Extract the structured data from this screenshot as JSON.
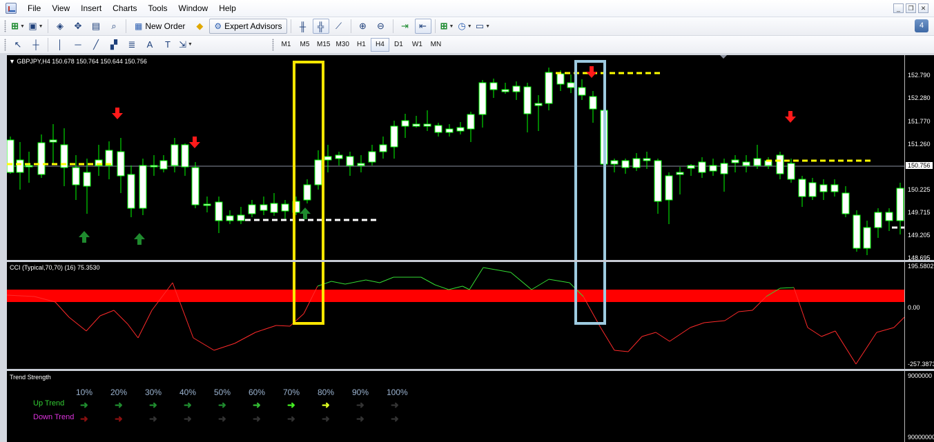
{
  "menu": {
    "items": [
      "File",
      "View",
      "Insert",
      "Charts",
      "Tools",
      "Window",
      "Help"
    ]
  },
  "window_controls": {
    "minimize": "_",
    "restore": "❐",
    "close": "✕"
  },
  "toolbar": {
    "new_order_label": "New Order",
    "expert_advisors_label": "Expert Advisors",
    "notification_count": "4",
    "timeframes": [
      "M1",
      "M5",
      "M15",
      "M30",
      "H1",
      "H4",
      "D1",
      "W1",
      "MN"
    ],
    "active_timeframe": "H4",
    "text_tool_label": "A",
    "text_label_tool": "T"
  },
  "chart": {
    "header": "GBPJPY,H4  150.678 150.764 150.644 150.756",
    "price_scale": [
      "152.790",
      "152.280",
      "151.770",
      "151.260",
      "150.225",
      "149.715",
      "149.205",
      "148.695"
    ],
    "current_price": "150.756",
    "colors": {
      "bull_body": "#ffffff",
      "wick": "#00ff00",
      "buy_arrow": "#1f8a2e",
      "sell_arrow": "#ff1a1a",
      "level_yellow": "#ffff00",
      "level_white": "#ffffff"
    }
  },
  "cci": {
    "header": "CCI (Typical,70,70) (16) 75.3530",
    "scale_top": "195.5802",
    "scale_zero": "0.00",
    "scale_bottom": "-257.3873",
    "colors": {
      "band": "#ff0000",
      "line_up": "#33dd33",
      "line_down": "#ff2a2a"
    }
  },
  "trend_strength": {
    "title": "Trend Strength",
    "percents": [
      "10%",
      "20%",
      "30%",
      "40%",
      "50%",
      "60%",
      "70%",
      "80%",
      "90%",
      "100%"
    ],
    "up_label": "Up Trend",
    "down_label": "Down Trend",
    "up_level": 0.8,
    "down_level": 0.2,
    "scale_top": "9000000",
    "scale_bottom": "90000000"
  },
  "highlight_boxes": [
    {
      "color": "#ffe600"
    },
    {
      "color": "#9ecbe0"
    }
  ]
}
